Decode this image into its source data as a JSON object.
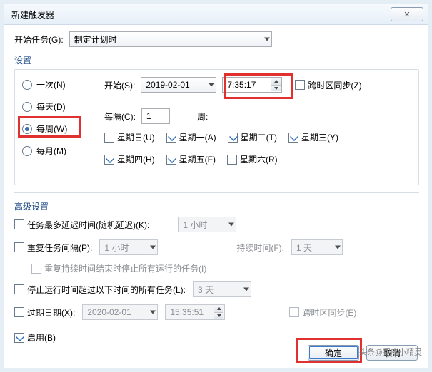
{
  "title": "新建触发器",
  "begin_task": {
    "label": "开始任务(G):",
    "value": "制定计划时"
  },
  "settings_caption": "设置",
  "freq": {
    "once": {
      "label": "一次(N)",
      "checked": false
    },
    "daily": {
      "label": "每天(D)",
      "checked": false
    },
    "weekly": {
      "label": "每周(W)",
      "checked": true
    },
    "monthly": {
      "label": "每月(M)",
      "checked": false
    }
  },
  "start": {
    "label": "开始(S):",
    "date": "2019-02-01",
    "time": "7:35:17",
    "sync_tz_label": "跨时区同步(Z)",
    "sync_tz_checked": false
  },
  "recur": {
    "every_label": "每隔(C):",
    "every_value": "1",
    "unit_label": "周:"
  },
  "days": {
    "sun": {
      "label": "星期日(U)",
      "checked": false
    },
    "mon": {
      "label": "星期一(A)",
      "checked": true
    },
    "tue": {
      "label": "星期二(T)",
      "checked": true
    },
    "wed": {
      "label": "星期三(Y)",
      "checked": true
    },
    "thu": {
      "label": "星期四(H)",
      "checked": true
    },
    "fri": {
      "label": "星期五(F)",
      "checked": true
    },
    "sat": {
      "label": "星期六(R)",
      "checked": false
    }
  },
  "advanced_caption": "高级设置",
  "adv": {
    "delay": {
      "label": "任务最多延迟时间(随机延迟)(K):",
      "checked": false,
      "value": "1 小时"
    },
    "repeat": {
      "label": "重复任务间隔(P):",
      "checked": false,
      "value": "1 小时",
      "duration_label": "持续时间(F):",
      "duration_value": "1 天"
    },
    "repeat_stop": {
      "label": "重复持续时间结束时停止所有运行的任务(I)",
      "checked": false
    },
    "stop": {
      "label": "停止运行时间超过以下时间的所有任务(L):",
      "checked": false,
      "value": "3 天"
    },
    "expire": {
      "label": "过期日期(X):",
      "checked": false,
      "date": "2020-02-01",
      "time": "15:35:51",
      "sync_tz_label": "跨时区同步(E)",
      "sync_tz_checked": false
    },
    "enabled": {
      "label": "启用(B)",
      "checked": true
    }
  },
  "buttons": {
    "ok": "确定",
    "cancel": "取消"
  },
  "watermark": "头条@程序小精灵"
}
